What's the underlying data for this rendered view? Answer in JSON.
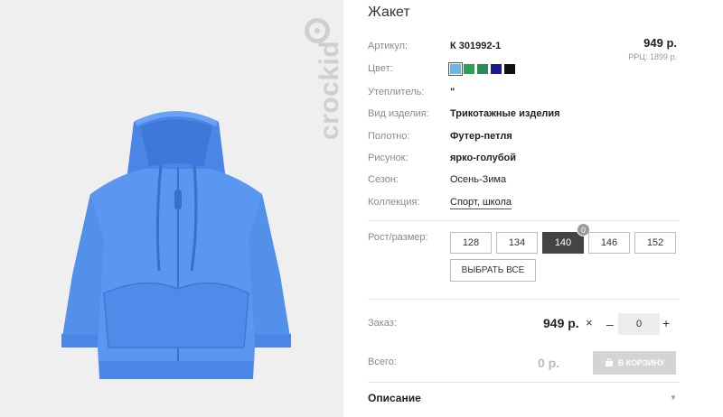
{
  "brand": {
    "name": "crockid"
  },
  "product": {
    "title": "Жакет",
    "price": "949 р.",
    "rrp": "РРЦ: 1899 р."
  },
  "attributes": {
    "article_label": "Артикул:",
    "article_value": "К 301992-1",
    "color_label": "Цвет:",
    "insulation_label": "Утеплитель:",
    "insulation_value": "\"",
    "type_label": "Вид изделия:",
    "type_value": "Трикотажные изделия",
    "fabric_label": "Полотно:",
    "fabric_value": "Футер-петля",
    "pattern_label": "Рисунок:",
    "pattern_value": "ярко-голубой",
    "season_label": "Сезон:",
    "season_value": "Осень-Зима",
    "collection_label": "Коллекция:",
    "collection_value": "Спорт, школа"
  },
  "colors": [
    "#6eb6e8",
    "#2e9c5a",
    "#2e8a55",
    "#1a1a8c",
    "#111111"
  ],
  "sizes": {
    "label": "Рост/размер:",
    "options": [
      "128",
      "134",
      "140",
      "146",
      "152"
    ],
    "selected": "140",
    "badge_count": "0",
    "select_all_label": "ВЫБРАТЬ ВСЕ"
  },
  "order": {
    "label": "Заказ:",
    "price": "949 р.",
    "times_symbol": "×",
    "minus_symbol": "–",
    "quantity": "0",
    "plus_symbol": "+"
  },
  "total": {
    "label": "Всего:",
    "value": "0 р.",
    "cart_button_label": "В КОРЗИНУ",
    "cart_icon": "cart-icon"
  },
  "description": {
    "title": "Описание",
    "toggle_icon": "chevron-down-icon"
  }
}
